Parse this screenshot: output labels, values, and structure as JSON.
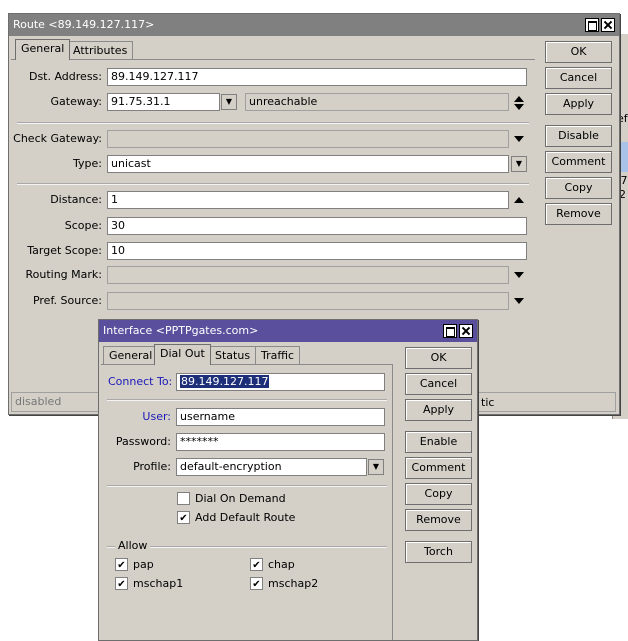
{
  "route_window": {
    "title": "Route <89.149.127.117>",
    "tabs": [
      {
        "label": "General",
        "selected": true
      },
      {
        "label": "Attributes",
        "selected": false
      }
    ],
    "fields": {
      "dst_address_label": "Dst. Address:",
      "dst_address_value": "89.149.127.117",
      "gateway_label": "Gateway:",
      "gateway_value": "91.75.31.1",
      "gateway_state": "unreachable",
      "check_gateway_label": "Check Gateway:",
      "check_gateway_value": "",
      "type_label": "Type:",
      "type_value": "unicast",
      "distance_label": "Distance:",
      "distance_value": "1",
      "scope_label": "Scope:",
      "scope_value": "30",
      "target_scope_label": "Target Scope:",
      "target_scope_value": "10",
      "routing_mark_label": "Routing Mark:",
      "routing_mark_value": "",
      "pref_source_label": "Pref. Source:",
      "pref_source_value": ""
    },
    "buttons": {
      "ok": "OK",
      "cancel": "Cancel",
      "apply": "Apply",
      "disable": "Disable",
      "comment": "Comment",
      "copy": "Copy",
      "remove": "Remove"
    },
    "status": "disabled"
  },
  "background": {
    "status_fragment": "tic",
    "fragment_1": "ef",
    "fragment_2": ".7",
    "fragment_3": "2"
  },
  "interface_window": {
    "title": "Interface <PPTPgates.com>",
    "tabs": [
      {
        "label": "General",
        "selected": false
      },
      {
        "label": "Dial Out",
        "selected": true
      },
      {
        "label": "Status",
        "selected": false
      },
      {
        "label": "Traffic",
        "selected": false
      }
    ],
    "fields": {
      "connect_to_label": "Connect To:",
      "connect_to_value": "89.149.127.117",
      "user_label": "User:",
      "user_value": "username",
      "password_label": "Password:",
      "password_value": "*******",
      "profile_label": "Profile:",
      "profile_value": "default-encryption"
    },
    "checkboxes": {
      "dial_on_demand": {
        "label": "Dial On Demand",
        "checked": false
      },
      "add_default_route": {
        "label": "Add Default Route",
        "checked": true
      }
    },
    "allow": {
      "title": "Allow",
      "pap": {
        "label": "pap",
        "checked": true
      },
      "chap": {
        "label": "chap",
        "checked": true
      },
      "mschap1": {
        "label": "mschap1",
        "checked": true
      },
      "mschap2": {
        "label": "mschap2",
        "checked": true
      }
    },
    "buttons": {
      "ok": "OK",
      "cancel": "Cancel",
      "apply": "Apply",
      "enable": "Enable",
      "comment": "Comment",
      "copy": "Copy",
      "remove": "Remove",
      "torch": "Torch"
    }
  }
}
